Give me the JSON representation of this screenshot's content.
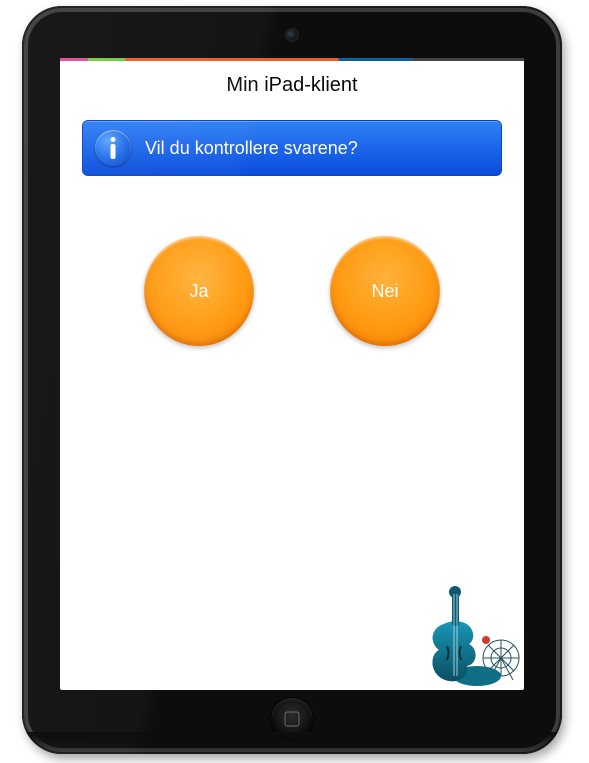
{
  "app": {
    "title": "Min iPad-klient"
  },
  "banner": {
    "message": "Vil du kontrollere svarene?"
  },
  "buttons": {
    "yes": "Ja",
    "no": "Nei"
  },
  "colors": {
    "banner_top": "#2f80f6",
    "banner_bottom": "#0a4cdc",
    "accent_orange": "#ff9a12"
  }
}
